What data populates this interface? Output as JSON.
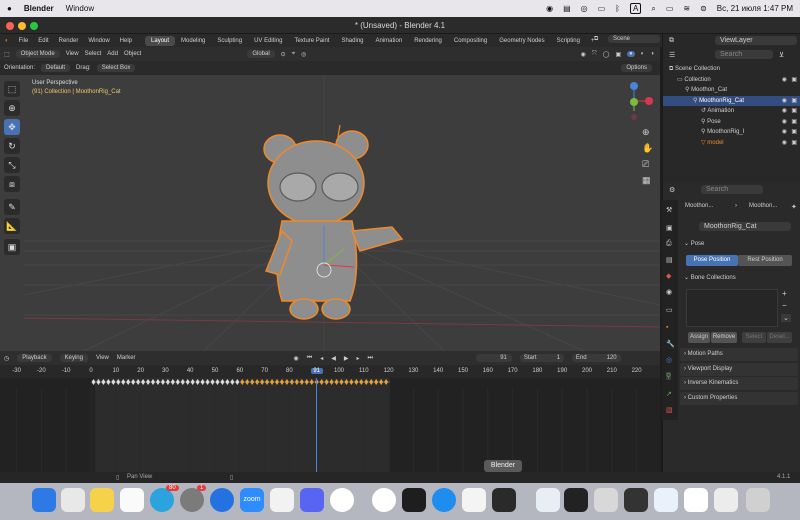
{
  "mac_menu": {
    "app": "Blender",
    "window": "Window",
    "keyboard": "A",
    "date_time": "Вс, 21 июля  1:47 PM"
  },
  "title": "* (Unsaved) - Blender 4.1",
  "menus": [
    "File",
    "Edit",
    "Render",
    "Window",
    "Help"
  ],
  "workspaces": [
    "Layout",
    "Modeling",
    "Sculpting",
    "UV Editing",
    "Texture Paint",
    "Shading",
    "Animation",
    "Rendering",
    "Compositing",
    "Geometry Nodes",
    "Scripting"
  ],
  "active_workspace": "Layout",
  "scene": "Scene",
  "view_layer": "ViewLayer",
  "header3d": {
    "mode": "Object Mode",
    "view": "View",
    "select": "Select",
    "add": "Add",
    "object": "Object",
    "transform": "Global"
  },
  "header3d_row2": {
    "orientation_label": "Orientation:",
    "orientation": "Default",
    "drag_label": "Drag:",
    "drag": "Select Box",
    "options": "Options"
  },
  "viewport": {
    "view_name": "User Perspective",
    "collection": "(91) Collection | MoothonRig_Cat"
  },
  "timeline": {
    "playback": "Playback",
    "keying": "Keying",
    "view": "View",
    "marker": "Marker",
    "current_frame": "91",
    "start_label": "Start",
    "start": "1",
    "end_label": "End",
    "end": "120",
    "ruler_ticks": [
      "-30",
      "-20",
      "-10",
      "0",
      "10",
      "20",
      "30",
      "40",
      "50",
      "60",
      "70",
      "80",
      "91",
      "100",
      "110",
      "120",
      "130",
      "140",
      "150",
      "160",
      "170",
      "180",
      "190",
      "200",
      "210",
      "220"
    ]
  },
  "status": {
    "pan": "Pan View",
    "version": "4.1.1"
  },
  "outliner": {
    "search": "Search",
    "items": [
      {
        "label": "Scene Collection",
        "indent": 0
      },
      {
        "label": "Collection",
        "indent": 1
      },
      {
        "label": "Moothon_Cat",
        "indent": 2
      },
      {
        "label": "MoothonRig_Cat",
        "indent": 3,
        "selected": true
      },
      {
        "label": "Animation",
        "indent": 4
      },
      {
        "label": "Pose",
        "indent": 4
      },
      {
        "label": "MoothonRig_I",
        "indent": 4
      },
      {
        "label": "model",
        "indent": 4,
        "orange": true
      }
    ]
  },
  "properties": {
    "search": "Search",
    "breadcrumb": [
      "Moothon...",
      "Moothon..."
    ],
    "object_name": "MoothonRig_Cat",
    "pose_section": "Pose",
    "pose_position": "Pose Position",
    "rest_position": "Rest Position",
    "bone_collections": "Bone Collections",
    "assign": "Assign",
    "remove": "Remove",
    "select": "Select",
    "deselect": "Desel...",
    "collapsed_sections": [
      "Motion Paths",
      "Viewport Display",
      "Inverse Kinematics",
      "Custom Properties"
    ]
  },
  "dock": {
    "tooltip": "Blender",
    "telegram_badge": "80",
    "settings_badge": "1",
    "zoom": "zoom"
  },
  "colors": {
    "accent": "#4772b3",
    "selection_orange": "#f0892a",
    "keyframe": "#e8a13a"
  }
}
